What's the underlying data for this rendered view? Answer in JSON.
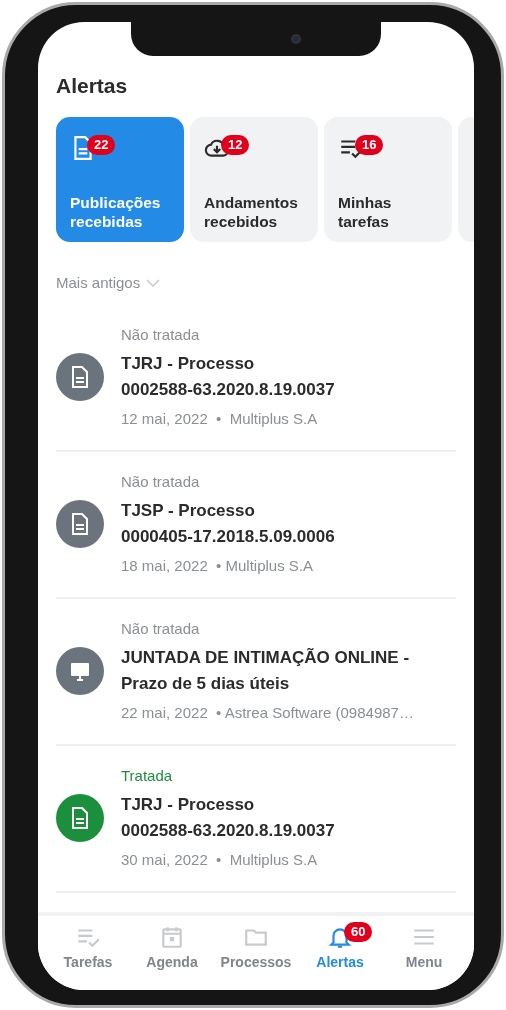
{
  "header": {
    "title": "Alertas"
  },
  "categories": [
    {
      "kind": "document",
      "badge": "22",
      "label": [
        "Publicações",
        "recebidas"
      ],
      "selected": true
    },
    {
      "kind": "cloud",
      "badge": "12",
      "label": [
        "Andamentos",
        "recebidos"
      ],
      "selected": false
    },
    {
      "kind": "tasks",
      "badge": "16",
      "label": [
        "Minhas",
        "tarefas"
      ],
      "selected": false
    },
    {
      "selected": false
    }
  ],
  "sort": {
    "label": "Mais antigos"
  },
  "alerts": [
    {
      "status": "Não tratada",
      "treated": false,
      "kind": "document",
      "title": [
        "TJRJ - Processo",
        "0002588-63.2020.8.19.0037"
      ],
      "meta": "12 mai, 2022  •  Multiplus S.A"
    },
    {
      "status": "Não tratada",
      "treated": false,
      "kind": "document",
      "title": [
        "TJSP - Processo",
        "0000405-17.2018.5.09.0006"
      ],
      "meta": "18 mai, 2022  • Multiplus S.A"
    },
    {
      "status": "Não tratada",
      "treated": false,
      "kind": "monitor",
      "title": [
        "JUNTADA DE INTIMAÇÃO ONLINE -",
        "Prazo de 5 dias úteis"
      ],
      "meta": "22 mai, 2022  • Astrea Software (0984987…"
    },
    {
      "status": "Tratada",
      "treated": true,
      "kind": "document",
      "title": [
        "TJRJ - Processo",
        "0002588-63.2020.8.19.0037"
      ],
      "meta": "30 mai, 2022  •  Multiplus S.A"
    }
  ],
  "tab_bar": [
    {
      "kind": "tasks",
      "label": "Tarefas",
      "selected": false
    },
    {
      "kind": "calendar",
      "label": "Agenda",
      "selected": false
    },
    {
      "kind": "folder",
      "label": "Processos",
      "selected": false
    },
    {
      "kind": "bell",
      "label": "Alertas",
      "selected": true,
      "badge": "60"
    },
    {
      "kind": "menu",
      "label": "Menu",
      "selected": false
    }
  ]
}
